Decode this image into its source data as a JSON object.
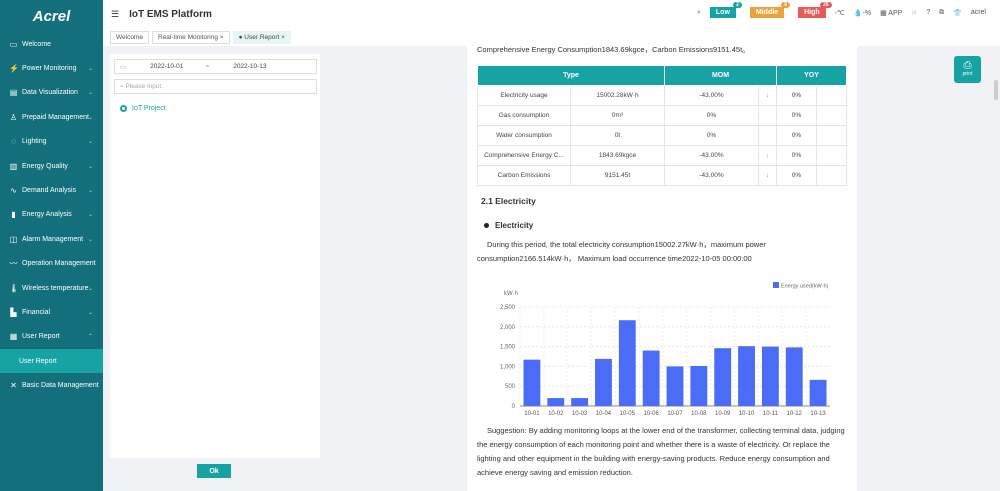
{
  "brand": "Acrel",
  "app_title": "IoT EMS Platform",
  "sidebar": {
    "items": [
      {
        "label": "Welcome",
        "icon": "monitor-icon",
        "chev": false
      },
      {
        "label": "Power Monitoring",
        "icon": "power-icon",
        "chev": true
      },
      {
        "label": "Data Visualization",
        "icon": "chart-icon",
        "chev": true
      },
      {
        "label": "Prepaid Management",
        "icon": "user-icon",
        "chev": true
      },
      {
        "label": "Lighting",
        "icon": "bulb-icon",
        "chev": true
      },
      {
        "label": "Energy Quality",
        "icon": "quality-icon",
        "chev": true
      },
      {
        "label": "Demand Analysis",
        "icon": "demand-icon",
        "chev": true
      },
      {
        "label": "Energy Analysis",
        "icon": "bar-icon",
        "chev": true
      },
      {
        "label": "Alarm Management",
        "icon": "alarm-icon",
        "chev": true
      },
      {
        "label": "Operation Management",
        "icon": "wave-icon",
        "chev": false
      },
      {
        "label": "Wireless temperature",
        "icon": "thermo-icon",
        "chev": true
      },
      {
        "label": "Financial",
        "icon": "finance-icon",
        "chev": true
      },
      {
        "label": "User Report",
        "icon": "report-icon",
        "chev": true,
        "expanded": true
      },
      {
        "label": "User Report",
        "sub": true
      },
      {
        "label": "Basic Data Management",
        "icon": "data-icon",
        "chev": false
      }
    ]
  },
  "header": {
    "alarms": [
      {
        "label": "Low",
        "count": "2",
        "color": "#17a2a4"
      },
      {
        "label": "Middle",
        "count": "0",
        "color": "#e8a33d"
      },
      {
        "label": "High",
        "count": "26",
        "color": "#e85a5a"
      }
    ],
    "temp": "-℃",
    "humidity": "-%",
    "app": "APP",
    "user": "acrel"
  },
  "tabs": [
    {
      "label": "Welcome"
    },
    {
      "label": "Real-time Monitoring ×"
    },
    {
      "label": "● User Report ×"
    }
  ],
  "filter": {
    "start": "2022-10-01",
    "sep": "~",
    "end": "2022-10-13",
    "placeholder": "Please input.",
    "tree_item": "IoT Project",
    "ok": "Ok"
  },
  "print_label": "print",
  "report": {
    "cut_line": "Comprehensive Energy Consumption1843.69kgce，Carbon Emissions9151.45t。",
    "table": {
      "headers": [
        "Type",
        "MOM",
        "YOY"
      ],
      "rows": [
        [
          "Electricity usage",
          "15002.28kW·h",
          "-43.00%",
          "↓",
          "0%"
        ],
        [
          "Gas consumption",
          "0m³",
          "0%",
          "",
          "0%"
        ],
        [
          "Water consumption",
          "0t",
          "0%",
          "",
          "0%"
        ],
        [
          "Comprehensive Energy C...",
          "1843.69kgce",
          "-43.00%",
          "↓",
          "0%"
        ],
        [
          "Carbon Emissions",
          "9151.45t",
          "-43.00%",
          "↓",
          "0%"
        ]
      ]
    },
    "section": "2.1 Electricity",
    "bullet": "Electricity",
    "summary": "During this period, the total electricity consumption15002.27kW·h，maximum power consumption2166.514kW·h， Maximum load occurrence time2022-10-05 00:00:00",
    "suggestion": "Suggestion: By adding monitoring loops at the lower end of the transformer, collecting terminal data, judging the energy consumption of each monitoring point and whether there is a waste of electricity. Or replace the lighting and other equipment in the building with energy-saving products. Reduce energy consumption and achieve energy saving and emission reduction."
  },
  "chart_data": {
    "type": "bar",
    "ylabel": "kW·h",
    "legend": "Energy used(kW·h)",
    "legend_position": "top-right",
    "grid": true,
    "categories": [
      "10-01",
      "10-02",
      "10-03",
      "10-04",
      "10-05",
      "10-06",
      "10-07",
      "10-08",
      "10-09",
      "10-10",
      "10-11",
      "10-12",
      "10-13"
    ],
    "values": [
      1170,
      200,
      200,
      1190,
      2166,
      1400,
      1000,
      1010,
      1460,
      1510,
      1500,
      1480,
      660
    ],
    "ylim": [
      0,
      2500
    ],
    "yticks": [
      "0",
      "500",
      "1,000",
      "1,500",
      "2,000",
      "2,500"
    ],
    "color": "#4a6cf7"
  }
}
